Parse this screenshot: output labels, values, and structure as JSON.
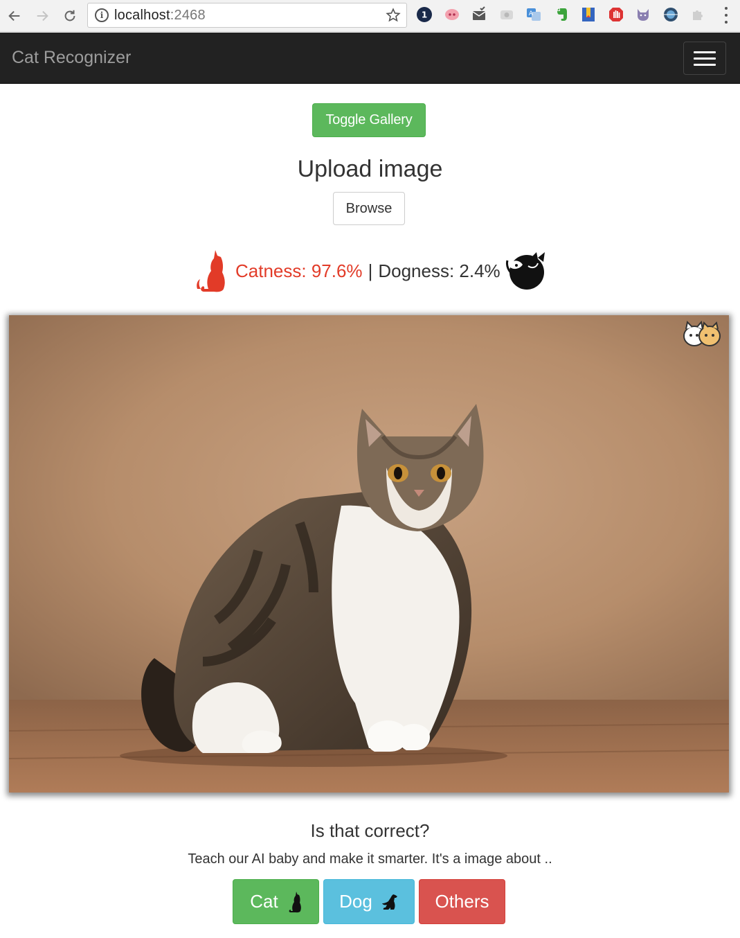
{
  "browser": {
    "url_host": "localhost",
    "url_port": ":2468",
    "icons": [
      "back-arrow-icon",
      "forward-arrow-icon",
      "reload-icon",
      "info-icon",
      "bookmark-star-icon",
      "menu-kebab-icon"
    ],
    "extensions": [
      "onepassword-icon",
      "pig-icon",
      "mail-check-icon",
      "camera-icon",
      "translate-icon",
      "evernote-icon",
      "bookmark-ribbon-icon",
      "stop-hand-icon",
      "cat-ext-icon",
      "globe-ext-icon",
      "puzzle-ext-icon"
    ]
  },
  "navbar": {
    "brand": "Cat Recognizer"
  },
  "main": {
    "toggle_label": "Toggle Gallery",
    "upload_title": "Upload image",
    "browse_label": "Browse"
  },
  "result": {
    "catness": "Catness: 97.6%",
    "separator": "|",
    "dogness": "Dogness: 2.4%"
  },
  "feedback": {
    "question": "Is that correct?",
    "prompt": "Teach our AI baby and make it smarter. It's a image about ..",
    "cat_label": "Cat",
    "dog_label": "Dog",
    "others_label": "Others"
  },
  "colors": {
    "success": "#5cb85c",
    "info": "#5bc0de",
    "danger": "#d9534f",
    "catness_red": "#e23b28",
    "navbar_bg": "#222222"
  }
}
